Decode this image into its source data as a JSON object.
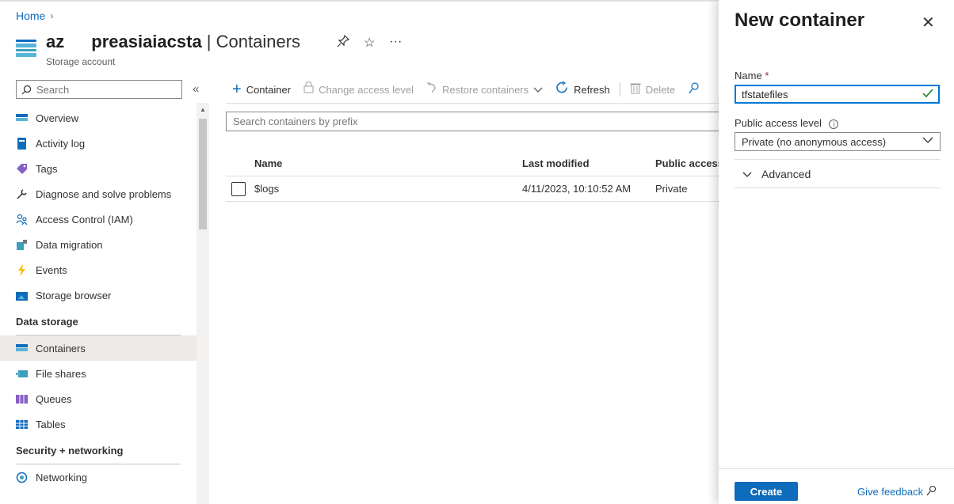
{
  "breadcrumb": {
    "home": "Home",
    "chevron": "›"
  },
  "resource": {
    "name_part1": "az",
    "name_part2": "preasiaiacsta",
    "separator": " | ",
    "page": "Containers",
    "subtitle": "Storage account",
    "icon": "storage-container-icon"
  },
  "header_actions": {
    "pin": "⚲",
    "favorite": "☆",
    "more": "···"
  },
  "sidebar": {
    "search_placeholder": "Search",
    "collapse": "«",
    "items": [
      {
        "label": "Overview",
        "icon": "overview-icon"
      },
      {
        "label": "Activity log",
        "icon": "activity-log-icon"
      },
      {
        "label": "Tags",
        "icon": "tag-icon"
      },
      {
        "label": "Diagnose and solve problems",
        "icon": "wrench-icon"
      },
      {
        "label": "Access Control (IAM)",
        "icon": "people-icon"
      },
      {
        "label": "Data migration",
        "icon": "data-migration-icon"
      },
      {
        "label": "Events",
        "icon": "lightning-icon"
      },
      {
        "label": "Storage browser",
        "icon": "storage-browser-icon"
      }
    ],
    "section_data_storage": "Data storage",
    "data_storage_items": [
      {
        "label": "Containers",
        "icon": "containers-icon",
        "active": true
      },
      {
        "label": "File shares",
        "icon": "file-shares-icon"
      },
      {
        "label": "Queues",
        "icon": "queues-icon"
      },
      {
        "label": "Tables",
        "icon": "tables-icon"
      }
    ],
    "section_security": "Security + networking",
    "security_items": [
      {
        "label": "Networking",
        "icon": "networking-icon"
      }
    ]
  },
  "toolbar": {
    "add_container": "Container",
    "change_access": "Change access level",
    "restore": "Restore containers",
    "refresh": "Refresh",
    "delete": "Delete"
  },
  "filter": {
    "placeholder": "Search containers by prefix"
  },
  "grid": {
    "columns": [
      "Name",
      "Last modified",
      "Public access"
    ],
    "rows": [
      {
        "name": "$logs",
        "last_modified": "4/11/2023, 10:10:52 AM",
        "public_access": "Private"
      }
    ]
  },
  "flyout": {
    "title": "New container",
    "close": "✕",
    "name_label": "Name",
    "required_mark": "*",
    "name_value": "tfstatefiles",
    "access_label": "Public access level",
    "access_value": "Private (no anonymous access)",
    "advanced": "Advanced",
    "create": "Create",
    "feedback": "Give feedback"
  },
  "colors": {
    "accent": "#0f6cbd",
    "active_bg": "#edebe9",
    "valid": "#107c10"
  }
}
